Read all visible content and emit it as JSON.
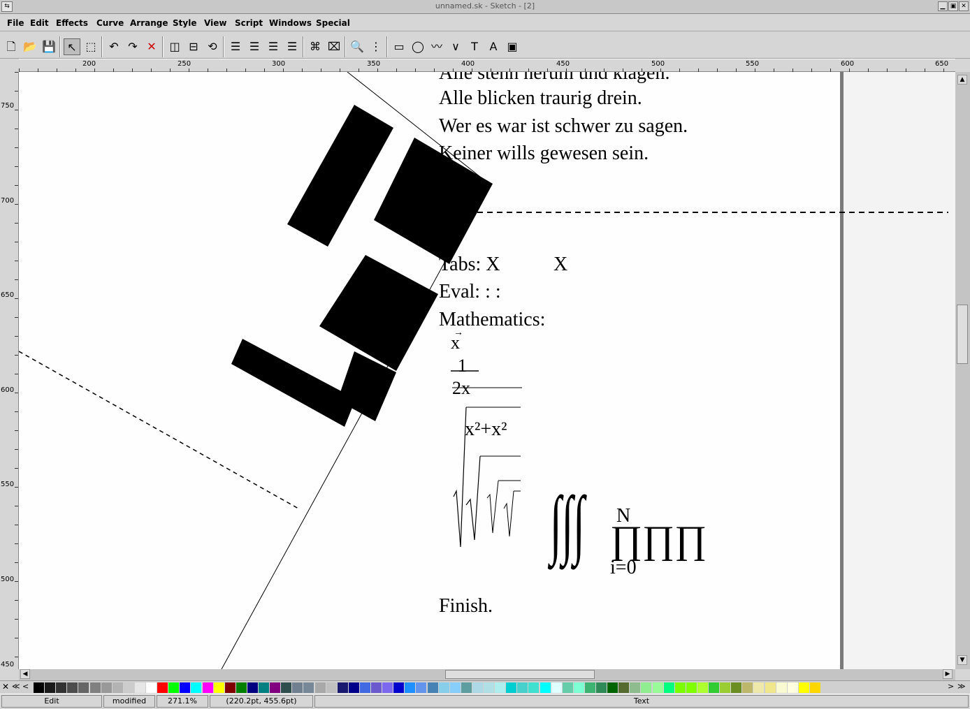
{
  "window": {
    "title": "unnamed.sk - Sketch - [2]"
  },
  "menu": [
    "File",
    "Edit",
    "Effects",
    "Curve",
    "Arrange",
    "Style",
    "View",
    "Script",
    "Windows",
    "Special"
  ],
  "toolbar": {
    "tools": [
      {
        "name": "new-file-icon",
        "glyph": "🗋"
      },
      {
        "name": "open-file-icon",
        "glyph": "📂"
      },
      {
        "name": "save-file-icon",
        "glyph": "💾"
      },
      {
        "name": "edit-tool-icon",
        "glyph": "↖",
        "selected": true
      },
      {
        "name": "select-tool-icon",
        "glyph": "⬚"
      },
      {
        "name": "undo-icon",
        "glyph": "↶"
      },
      {
        "name": "redo-icon",
        "glyph": "↷"
      },
      {
        "name": "delete-icon",
        "glyph": "✕",
        "color": "#cc0000"
      },
      {
        "name": "flip-horizontal-icon",
        "glyph": "◫"
      },
      {
        "name": "flip-vertical-icon",
        "glyph": "⊟"
      },
      {
        "name": "rotate-icon",
        "glyph": "⟲"
      },
      {
        "name": "align-left-icon",
        "glyph": "☰"
      },
      {
        "name": "align-center-icon",
        "glyph": "☰"
      },
      {
        "name": "align-right-icon",
        "glyph": "☰"
      },
      {
        "name": "align-justify-icon",
        "glyph": "☰"
      },
      {
        "name": "group-icon",
        "glyph": "⌘"
      },
      {
        "name": "ungroup-icon",
        "glyph": "⌧"
      },
      {
        "name": "zoom-icon",
        "glyph": "🔍"
      },
      {
        "name": "grid-icon",
        "glyph": "⋮"
      },
      {
        "name": "rectangle-tool-icon",
        "glyph": "▭"
      },
      {
        "name": "ellipse-tool-icon",
        "glyph": "◯"
      },
      {
        "name": "freehand-tool-icon",
        "glyph": "〰"
      },
      {
        "name": "polyline-tool-icon",
        "glyph": "∨"
      },
      {
        "name": "text-tool-icon",
        "glyph": "T"
      },
      {
        "name": "text-along-path-icon",
        "glyph": "A"
      },
      {
        "name": "image-tool-icon",
        "glyph": "▣"
      }
    ]
  },
  "rulers": {
    "horizontal": [
      "200",
      "250",
      "300",
      "350",
      "400",
      "450",
      "500",
      "550",
      "600",
      "650"
    ],
    "vertical": [
      "750",
      "700",
      "650",
      "600",
      "550",
      "500",
      "450"
    ]
  },
  "canvas": {
    "poem": [
      "Alle stehn herum und klagen.",
      "Alle blicken traurig drein.",
      "Wer es war ist schwer zu sagen.",
      "Keiner wills gewesen sein."
    ],
    "tabs_label": "Tabs: X",
    "tabs_value": "X",
    "eval": "Eval: : :",
    "mathematics": "Mathematics:",
    "math_vec": "x",
    "frac_num": "1",
    "frac_den": "2x",
    "sqrt_expr": "x²+x²",
    "sum_upper": "N",
    "sum_lower": "i=0",
    "finish": "Finish."
  },
  "palette": [
    "#000000",
    "#1a1a1a",
    "#333333",
    "#4d4d4d",
    "#666666",
    "#808080",
    "#999999",
    "#b3b3b3",
    "#cccccc",
    "#e6e6e6",
    "#ffffff",
    "#ff0000",
    "#00ff00",
    "#0000ff",
    "#00ffff",
    "#ff00ff",
    "#ffff00",
    "#800000",
    "#008000",
    "#000080",
    "#008080",
    "#800080",
    "#2f4f4f",
    "#708090",
    "#778899",
    "#a9a9a9",
    "#c0c0c0",
    "#191970",
    "#00008b",
    "#4169e1",
    "#6a5acd",
    "#7b68ee",
    "#0000cd",
    "#1e90ff",
    "#6495ed",
    "#4682b4",
    "#87ceeb",
    "#87cefa",
    "#5f9ea0",
    "#add8e6",
    "#b0e0e6",
    "#afeeee",
    "#00ced1",
    "#48d1cc",
    "#40e0d0",
    "#00ffff",
    "#e0ffff",
    "#66cdaa",
    "#7fffd4",
    "#3cb371",
    "#2e8b57",
    "#006400",
    "#556b2f",
    "#8fbc8f",
    "#90ee90",
    "#98fb98",
    "#00ff7f",
    "#7cfc00",
    "#7fff00",
    "#adff2f",
    "#32cd32",
    "#9acd32",
    "#6b8e23",
    "#bdb76b",
    "#eee8aa",
    "#f0e68c",
    "#fafad2",
    "#ffffe0",
    "#ffff00",
    "#ffd700"
  ],
  "status": {
    "mode": "Edit",
    "state": "modified",
    "zoom": "271.1%",
    "coords": "(220.2pt, 455.6pt)",
    "type": "Text"
  }
}
